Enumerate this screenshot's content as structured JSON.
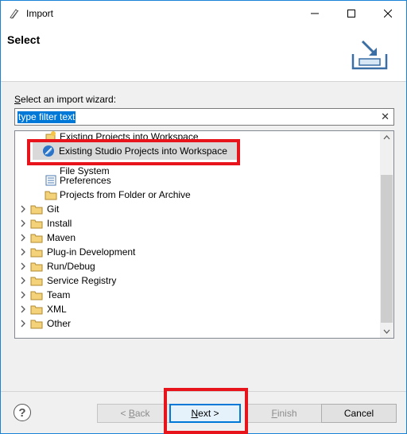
{
  "window": {
    "title": "Import",
    "accent": "#1883d7"
  },
  "banner": {
    "title": "Select",
    "icon": "import-wizard-graphic"
  },
  "wizard": {
    "label_prefix": "S",
    "label_rest": "elect an import wizard:",
    "filter_value": "type filter text",
    "clear_icon": "✕"
  },
  "tree": {
    "partial_item": "Existing Projects into Workspace",
    "selected_item": "Existing Studio Projects into Workspace",
    "partial_item2": "File System",
    "children": [
      {
        "label": "Preferences",
        "icon": "preferences-icon"
      },
      {
        "label": "Projects from Folder or Archive",
        "icon": "folder-icon"
      }
    ],
    "categories": [
      "Git",
      "Install",
      "Maven",
      "Plug-in Development",
      "Run/Debug",
      "Service Registry",
      "Team",
      "XML",
      "Other"
    ]
  },
  "buttons": {
    "back_lt": "< ",
    "back_u": "B",
    "back_rest": "ack",
    "next_u": "N",
    "next_rest": "ext >",
    "finish_u": "F",
    "finish_rest": "inish",
    "cancel": "Cancel",
    "help": "?"
  },
  "colors": {
    "highlight": "#e8141c",
    "selection": "#0078d7"
  }
}
